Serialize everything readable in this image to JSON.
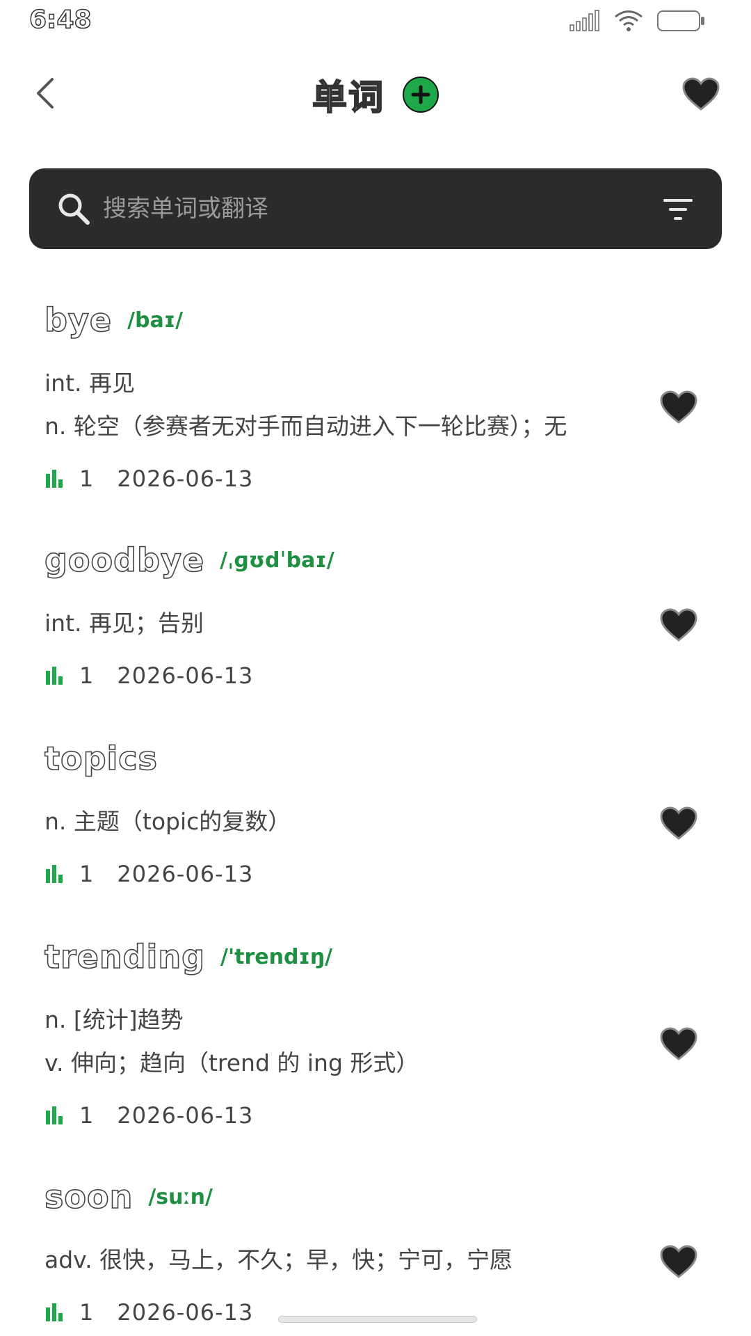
{
  "status": {
    "time": "6:48",
    "icons": [
      "signal-icon",
      "wifi-icon",
      "battery-icon"
    ]
  },
  "header": {
    "title": "单词",
    "icons": {
      "back": "chevron-left-icon",
      "add": "plus-circle-icon",
      "favorites": "heart-icon"
    },
    "accent": "#1fa84a"
  },
  "search": {
    "placeholder": "搜索单词或翻译",
    "value": "",
    "icons": {
      "search": "search-icon",
      "filter": "filter-icon"
    }
  },
  "words": [
    {
      "word": "bye",
      "phonetic": "/baɪ/",
      "definitions": [
        "int. 再见",
        "n. 轮空（参赛者无对手而自动进入下一轮比赛）；无"
      ],
      "count": "1",
      "date": "2026-06-13",
      "favorited": true
    },
    {
      "word": "goodbye",
      "phonetic": "/ˌɡʊdˈbaɪ/",
      "definitions": [
        "int. 再见；告别"
      ],
      "count": "1",
      "date": "2026-06-13",
      "favorited": true
    },
    {
      "word": "topics",
      "phonetic": "",
      "definitions": [
        "n. 主题（topic的复数）"
      ],
      "count": "1",
      "date": "2026-06-13",
      "favorited": true
    },
    {
      "word": "trending",
      "phonetic": "/'trendɪŋ/",
      "definitions": [
        "n. [统计]趋势",
        "v. 伸向；趋向（trend 的 ing 形式）"
      ],
      "count": "1",
      "date": "2026-06-13",
      "favorited": true
    },
    {
      "word": "soon",
      "phonetic": "/suːn/",
      "definitions": [
        "adv. 很快，马上，不久；早，快；宁可，宁愿"
      ],
      "count": "1",
      "date": "2026-06-13",
      "favorited": true
    }
  ]
}
